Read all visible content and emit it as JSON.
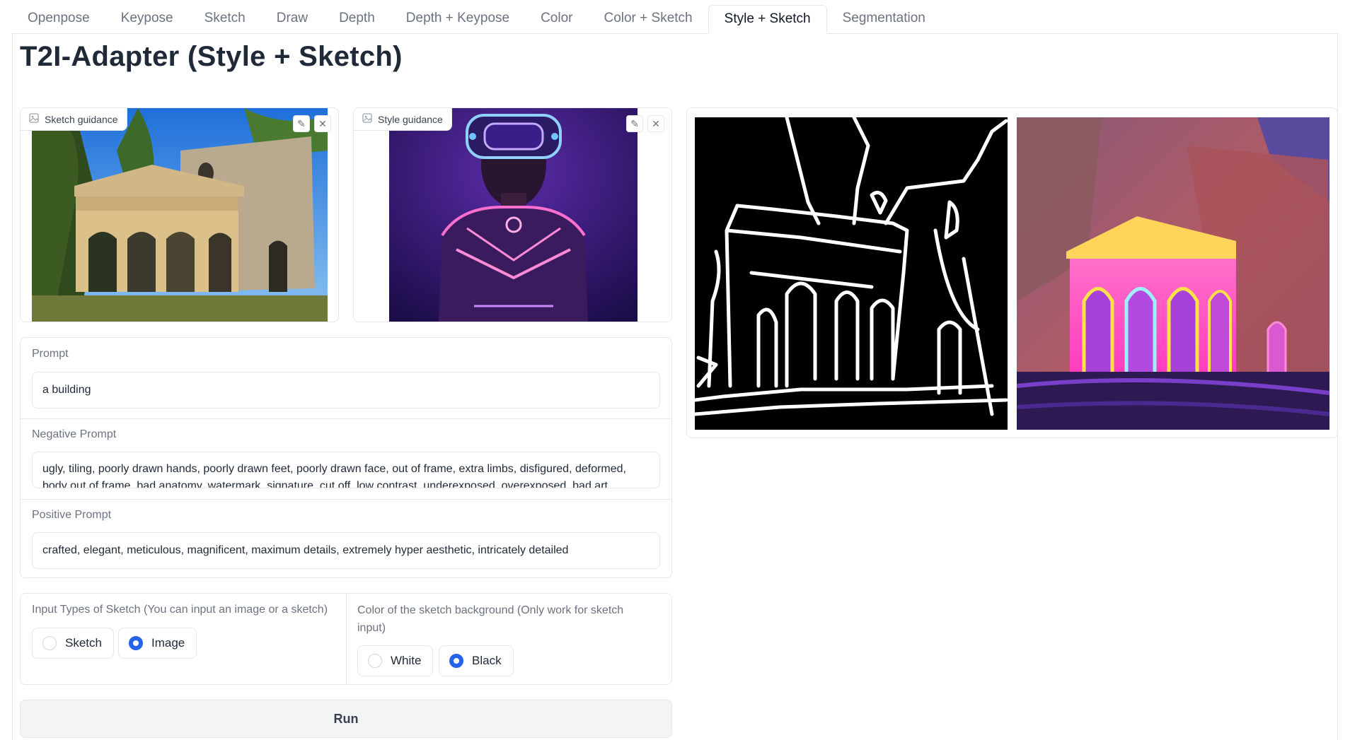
{
  "tabs": [
    {
      "label": "Openpose"
    },
    {
      "label": "Keypose"
    },
    {
      "label": "Sketch"
    },
    {
      "label": "Draw"
    },
    {
      "label": "Depth"
    },
    {
      "label": "Depth + Keypose"
    },
    {
      "label": "Color"
    },
    {
      "label": "Color + Sketch"
    },
    {
      "label": "Style + Sketch",
      "active": true
    },
    {
      "label": "Segmentation"
    }
  ],
  "page_title": "T2I-Adapter (Style + Sketch)",
  "sketch_guidance": {
    "label": "Sketch guidance"
  },
  "style_guidance": {
    "label": "Style guidance"
  },
  "icons": {
    "image": "image-icon",
    "edit": "pencil-icon",
    "clear": "close-icon"
  },
  "prompt": {
    "label": "Prompt",
    "value": "a building"
  },
  "negative_prompt": {
    "label": "Negative Prompt",
    "value": "ugly, tiling, poorly drawn hands, poorly drawn feet, poorly drawn face, out of frame, extra limbs, disfigured, deformed, body out of frame, bad anatomy, watermark, signature, cut off, low contrast, underexposed, overexposed, bad art"
  },
  "positive_prompt": {
    "label": "Positive Prompt",
    "value": "crafted, elegant, meticulous, magnificent, maximum details, extremely hyper aesthetic, intricately detailed"
  },
  "input_type": {
    "label": "Input Types of Sketch (You can input an image or a sketch)",
    "options": [
      "Sketch",
      "Image"
    ],
    "selected": "Image"
  },
  "sketch_bg": {
    "label": "Color of the sketch background (Only work for sketch input)",
    "options": [
      "White",
      "Black"
    ],
    "selected": "Black"
  },
  "run_button": "Run",
  "colors": {
    "accent": "#2563eb",
    "border": "#e5e7eb",
    "muted_text": "#6b7280"
  }
}
